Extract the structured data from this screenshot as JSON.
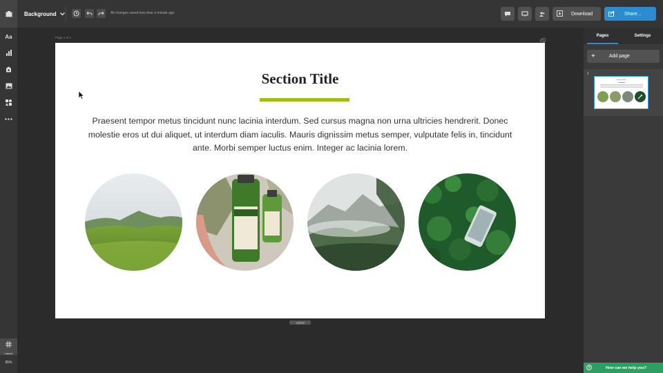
{
  "topbar": {
    "background_label": "Background",
    "saved_status": "All changes saved less than a minute ago",
    "download_label": "Download",
    "share_label": "Share..."
  },
  "leftbar": {
    "text_tool_label": "Aa",
    "layout_label": "Layout",
    "zoom": "95%"
  },
  "canvas": {
    "page_label": "Page 1 of 1",
    "section_title": "Section Title",
    "body_text": "Praesent tempor metus tincidunt nunc lacinia interdum. Sed cursus magna non urna ultricies hendrerit. Donec molestie eros ut dui aliquet, ut interdum diam iaculis. Mauris dignissim metus semper, vulputate felis in, tincidunt ante. Morbi semper luctus enim. Integer ac lacinia lorem.",
    "accent_color": "#a2bc14",
    "images": [
      {
        "name": "green-hills-photo"
      },
      {
        "name": "maui-moisture-bottles-photo"
      },
      {
        "name": "misty-forest-mountain-photo"
      },
      {
        "name": "leaves-phone-photo"
      }
    ]
  },
  "rightpanel": {
    "tabs": [
      {
        "label": "Pages"
      },
      {
        "label": "Settings"
      }
    ],
    "add_page_label": "Add page",
    "page_number": "1",
    "thumb_title": "Section Title"
  },
  "help": {
    "label": "How can we help you?"
  },
  "colors": {
    "share_blue": "#2d8ccf",
    "help_green": "#2e9e62"
  }
}
